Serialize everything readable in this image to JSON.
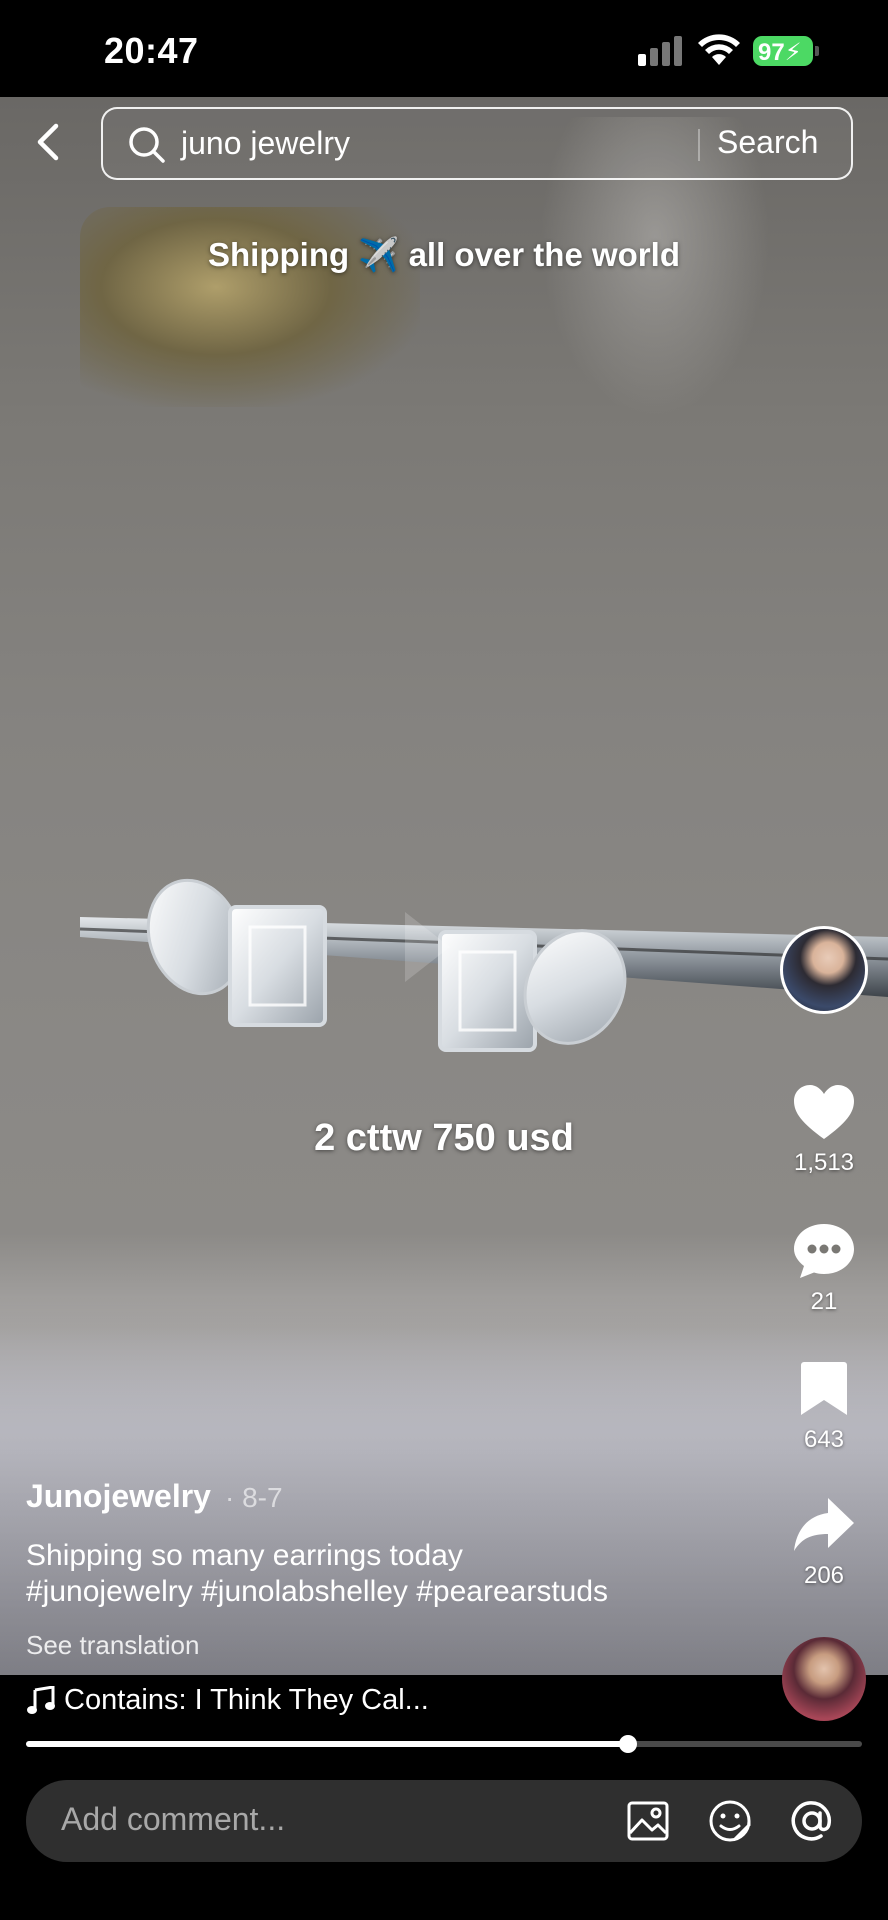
{
  "status_bar": {
    "time": "20:47",
    "battery": "97"
  },
  "search": {
    "query": "juno jewelry",
    "button_label": "Search"
  },
  "video": {
    "caption_top": "Shipping ✈️ all over the world",
    "caption_price": "2 cttw 750 usd"
  },
  "rail": {
    "likes": "1,513",
    "comments": "21",
    "saves": "643",
    "shares": "206"
  },
  "post": {
    "author": "Junojewelry",
    "date": "· 8-7",
    "description": "Shipping so many earrings today",
    "hashtags": "#junojewelry #junolabshelley #pearearstuds",
    "see_translation": "See translation"
  },
  "music": {
    "title": "Contains: I Think They Cal..."
  },
  "progress": {
    "fraction": 0.72
  },
  "comment": {
    "placeholder": "Add comment..."
  },
  "icons": [
    "back-icon",
    "search-icon",
    "heart-icon",
    "comment-icon",
    "bookmark-icon",
    "share-icon",
    "music-note-icon",
    "image-icon",
    "emoji-icon",
    "mention-icon"
  ]
}
